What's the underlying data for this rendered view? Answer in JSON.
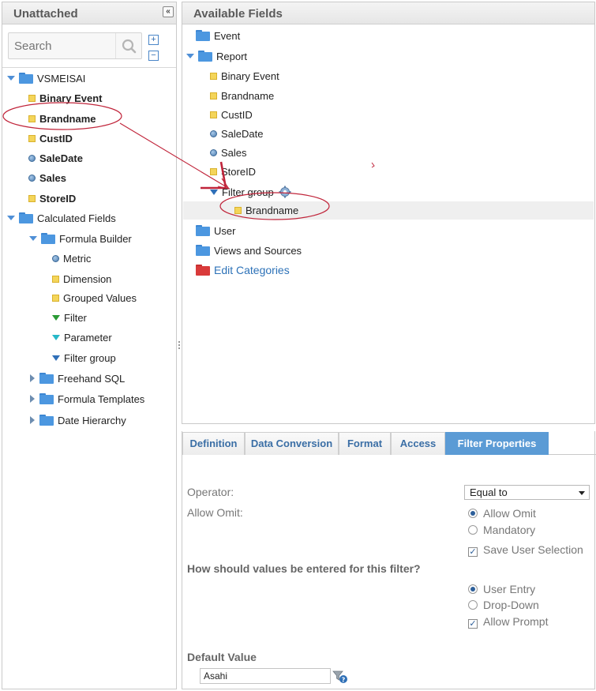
{
  "left_panel": {
    "title": "Unattached",
    "search_placeholder": "Search",
    "root_folder": "VSMEISAI",
    "fields": [
      "Binary Event",
      "Brandname",
      "CustID",
      "SaleDate",
      "Sales",
      "StoreID"
    ],
    "calculated_fields": "Calculated Fields",
    "formula_builder": "Formula Builder",
    "formula_items": [
      "Metric",
      "Dimension",
      "Grouped Values",
      "Filter",
      "Parameter",
      "Filter group"
    ],
    "other_folders": [
      "Freehand SQL",
      "Formula Templates",
      "Date Hierarchy"
    ]
  },
  "available_fields": {
    "title": "Available Fields",
    "event": "Event",
    "report": "Report",
    "report_items": [
      "Binary Event",
      "Brandname",
      "CustID",
      "SaleDate",
      "Sales",
      "StoreID"
    ],
    "filter_group": "Filter group",
    "filter_group_child": "Brandname",
    "user": "User",
    "views_and_sources": "Views and Sources",
    "edit_categories": "Edit Categories"
  },
  "tabs": [
    "Definition",
    "Data Conversion",
    "Format",
    "Access",
    "Filter Properties"
  ],
  "filter_properties": {
    "operator_label": "Operator:",
    "operator_value": "Equal to",
    "allow_omit_label": "Allow Omit:",
    "allow_omit_opt": "Allow Omit",
    "mandatory_opt": "Mandatory",
    "save_user_selection": "Save User Selection",
    "question": "How should values be entered for this filter?",
    "user_entry": "User Entry",
    "drop_down": "Drop-Down",
    "allow_prompt": "Allow Prompt",
    "default_value_label": "Default Value",
    "default_value": "Asahi"
  },
  "colors": {
    "accent": "#5b9bd5",
    "annotation": "#c0243a",
    "link": "#2d72b8"
  }
}
